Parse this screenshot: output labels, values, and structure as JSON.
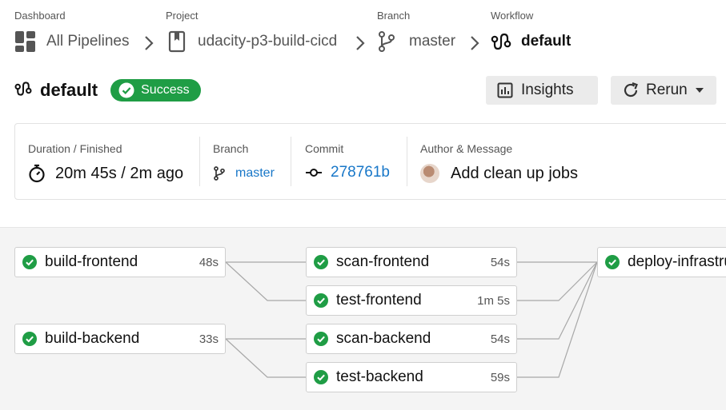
{
  "breadcrumb": {
    "dashboard": {
      "label": "Dashboard",
      "value": "All Pipelines"
    },
    "project": {
      "label": "Project",
      "value": "udacity-p3-build-cicd"
    },
    "branch": {
      "label": "Branch",
      "value": "master"
    },
    "workflow": {
      "label": "Workflow",
      "value": "default"
    }
  },
  "workflow": {
    "title": "default",
    "status": "Success"
  },
  "buttons": {
    "insights": "Insights",
    "rerun": "Rerun"
  },
  "info": {
    "duration": {
      "label": "Duration / Finished",
      "value": "20m 45s / 2m ago"
    },
    "branch": {
      "label": "Branch",
      "value": "master"
    },
    "commit": {
      "label": "Commit",
      "value": "278761b"
    },
    "author": {
      "label": "Author & Message",
      "value": "Add clean up jobs"
    }
  },
  "jobs": [
    {
      "name": "build-frontend",
      "time": "48s",
      "status": "success"
    },
    {
      "name": "build-backend",
      "time": "33s",
      "status": "success"
    },
    {
      "name": "scan-frontend",
      "time": "54s",
      "status": "success"
    },
    {
      "name": "test-frontend",
      "time": "1m 5s",
      "status": "success"
    },
    {
      "name": "scan-backend",
      "time": "54s",
      "status": "success"
    },
    {
      "name": "test-backend",
      "time": "59s",
      "status": "success"
    },
    {
      "name": "deploy-infrastructure",
      "time": "",
      "status": "success"
    }
  ],
  "colors": {
    "success": "#1f9d45",
    "link": "#1877c8"
  }
}
